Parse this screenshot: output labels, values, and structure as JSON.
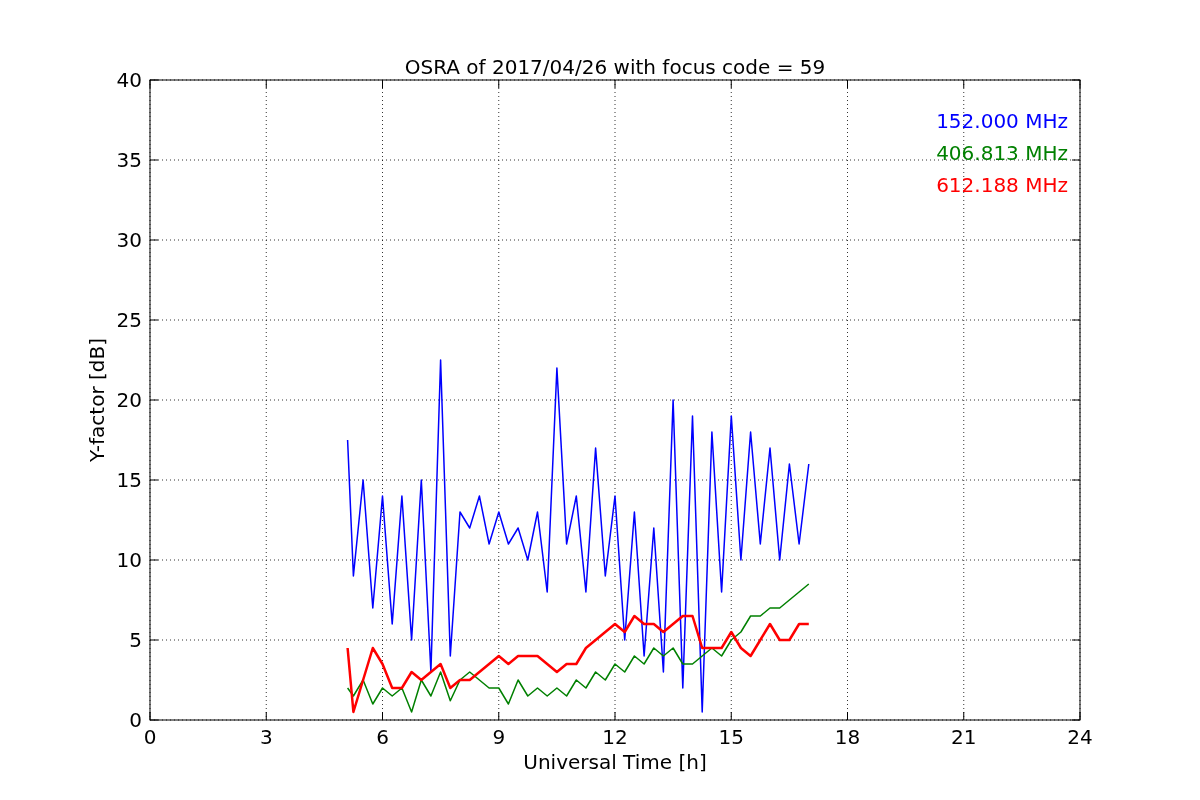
{
  "figure": {
    "chart_data": {
      "type": "line",
      "title": "OSRA of 2017/04/26 with focus code = 59",
      "xlabel": "Universal Time [h]",
      "ylabel": "Y-factor [dB]",
      "x": [
        5.1,
        5.25,
        5.5,
        5.75,
        6,
        6.25,
        6.5,
        6.75,
        7,
        7.25,
        7.5,
        7.75,
        8,
        8.25,
        8.5,
        8.75,
        9,
        9.25,
        9.5,
        9.75,
        10,
        10.25,
        10.5,
        10.75,
        11,
        11.25,
        11.5,
        11.75,
        12,
        12.25,
        12.5,
        12.75,
        13,
        13.25,
        13.5,
        13.75,
        14,
        14.25,
        14.5,
        14.75,
        15,
        15.25,
        15.5,
        15.75,
        16,
        16.25,
        16.5,
        16.75,
        17
      ],
      "series": [
        {
          "name": "152.000 MHz",
          "color": "#0000ff",
          "values": [
            17.5,
            9,
            15,
            7,
            14,
            6,
            14,
            5,
            15,
            3,
            22.5,
            4,
            13,
            12,
            14,
            11,
            13,
            11,
            12,
            10,
            13,
            8,
            22,
            11,
            14,
            8,
            17,
            9,
            14,
            5,
            13,
            4,
            12,
            3,
            20,
            2,
            19,
            0.5,
            18,
            8,
            19,
            10,
            18,
            11,
            17,
            10,
            16,
            11,
            16
          ]
        },
        {
          "name": "406.813 MHz",
          "color": "#008000",
          "values": [
            2,
            1.5,
            2.5,
            1,
            2,
            1.5,
            2,
            0.5,
            2.5,
            1.5,
            3,
            1.2,
            2.5,
            3,
            2.5,
            2,
            2,
            1,
            2.5,
            1.5,
            2,
            1.5,
            2,
            1.5,
            2.5,
            2,
            3,
            2.5,
            3.5,
            3,
            4,
            3.5,
            4.5,
            4,
            4.5,
            3.5,
            3.5,
            4,
            4.5,
            4,
            5,
            5.5,
            6.5,
            6.5,
            7,
            7,
            7.5,
            8,
            8.5
          ]
        },
        {
          "name": "612.188 MHz",
          "color": "#ff0000",
          "values": [
            4.5,
            0.5,
            2.5,
            4.5,
            3.5,
            2,
            2,
            3,
            2.5,
            3,
            3.5,
            2,
            2.5,
            2.5,
            3,
            3.5,
            4,
            3.5,
            4,
            4,
            4,
            3.5,
            3,
            3.5,
            3.5,
            4.5,
            5,
            5.5,
            6,
            5.5,
            6.5,
            6,
            6,
            5.5,
            6,
            6.5,
            6.5,
            4.5,
            4.5,
            4.5,
            5.5,
            4.5,
            4,
            5,
            6,
            5,
            5,
            6,
            6
          ]
        }
      ],
      "grid": true,
      "xlim": [
        0,
        24
      ],
      "ylim": [
        0,
        40
      ],
      "xticks": [
        0,
        3,
        6,
        9,
        12,
        15,
        18,
        21,
        24
      ],
      "yticks": [
        0,
        5,
        10,
        15,
        20,
        25,
        30,
        35,
        40
      ]
    }
  }
}
